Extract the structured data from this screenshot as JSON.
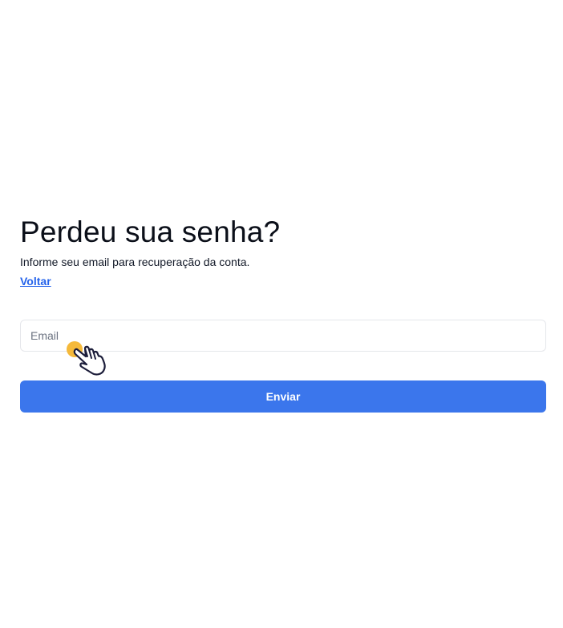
{
  "page": {
    "title": "Perdeu sua senha?",
    "subtitle": "Informe seu email para recuperação da conta.",
    "back_link": "Voltar"
  },
  "form": {
    "email_placeholder": "Email",
    "submit_label": "Enviar"
  },
  "colors": {
    "accent": "#3b76ec",
    "link": "#2563eb",
    "cursor_dot": "#f5b93a"
  },
  "icons": {
    "cursor": "hand-pointer-icon"
  }
}
